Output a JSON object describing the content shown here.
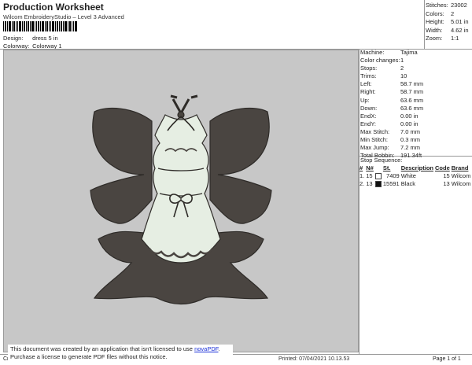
{
  "header": {
    "title": "Production Worksheet",
    "subtitle": "Wilcom EmbroideryStudio – Level 3 Advanced",
    "design_label": "Design:",
    "design_value": "dress 5 in",
    "colorway_label": "Colorway:",
    "colorway_value": "Colorway 1"
  },
  "summary": {
    "stitches_label": "Stitches:",
    "stitches_value": "23002",
    "colors_label": "Colors:",
    "colors_value": "2",
    "height_label": "Height:",
    "height_value": "5.01 in",
    "width_label": "Width:",
    "width_value": "4.62 in",
    "zoom_label": "Zoom:",
    "zoom_value": "1:1"
  },
  "machine": {
    "rows": [
      {
        "label": "Machine:",
        "value": "Tajima"
      },
      {
        "label": "Color changes:",
        "value": "1"
      },
      {
        "label": "Stops:",
        "value": "2"
      },
      {
        "label": "Trims:",
        "value": "10"
      },
      {
        "label": "Left:",
        "value": "58.7 mm"
      },
      {
        "label": "Right:",
        "value": "58.7 mm"
      },
      {
        "label": "Up:",
        "value": "63.6 mm"
      },
      {
        "label": "Down:",
        "value": "63.6 mm"
      },
      {
        "label": "EndX:",
        "value": "0.00 in"
      },
      {
        "label": "EndY:",
        "value": "0.00 in"
      },
      {
        "label": "Max Stitch:",
        "value": "7.0 mm"
      },
      {
        "label": "Min Stitch:",
        "value": "0.3 mm"
      },
      {
        "label": "Max Jump:",
        "value": "7.2 mm"
      },
      {
        "label": "Total Bobbin:",
        "value": "191.34ft"
      }
    ]
  },
  "stop_sequence": {
    "title": "Stop Sequence:",
    "headers": [
      "#",
      "N#",
      "St.",
      "Description",
      "Code",
      "Brand"
    ],
    "rows": [
      {
        "num": "1.",
        "n": "15",
        "swatch": "#ffffff",
        "st": "7409",
        "desc": "White",
        "code": "15",
        "brand": "Wilcom"
      },
      {
        "num": "2.",
        "n": "13",
        "swatch": "#111111",
        "st": "15591",
        "desc": "Black",
        "code": "13",
        "brand": "Wilcom"
      }
    ]
  },
  "footer": {
    "left": "Cr",
    "printed": "Printed: 07/04/2021 10.13.53",
    "page": "Page 1 of 1",
    "notice_line1_prefix": "This document was created by an application that isn't licensed to use ",
    "notice_link": "novaPDF",
    "notice_line1_suffix": ".",
    "notice_line2": "Purchase a license to generate PDF files without this notice."
  },
  "colors": {
    "fill_dark": "#4a4541",
    "fill_light": "#e6eee3",
    "design_bg": "#c7c7c7"
  }
}
